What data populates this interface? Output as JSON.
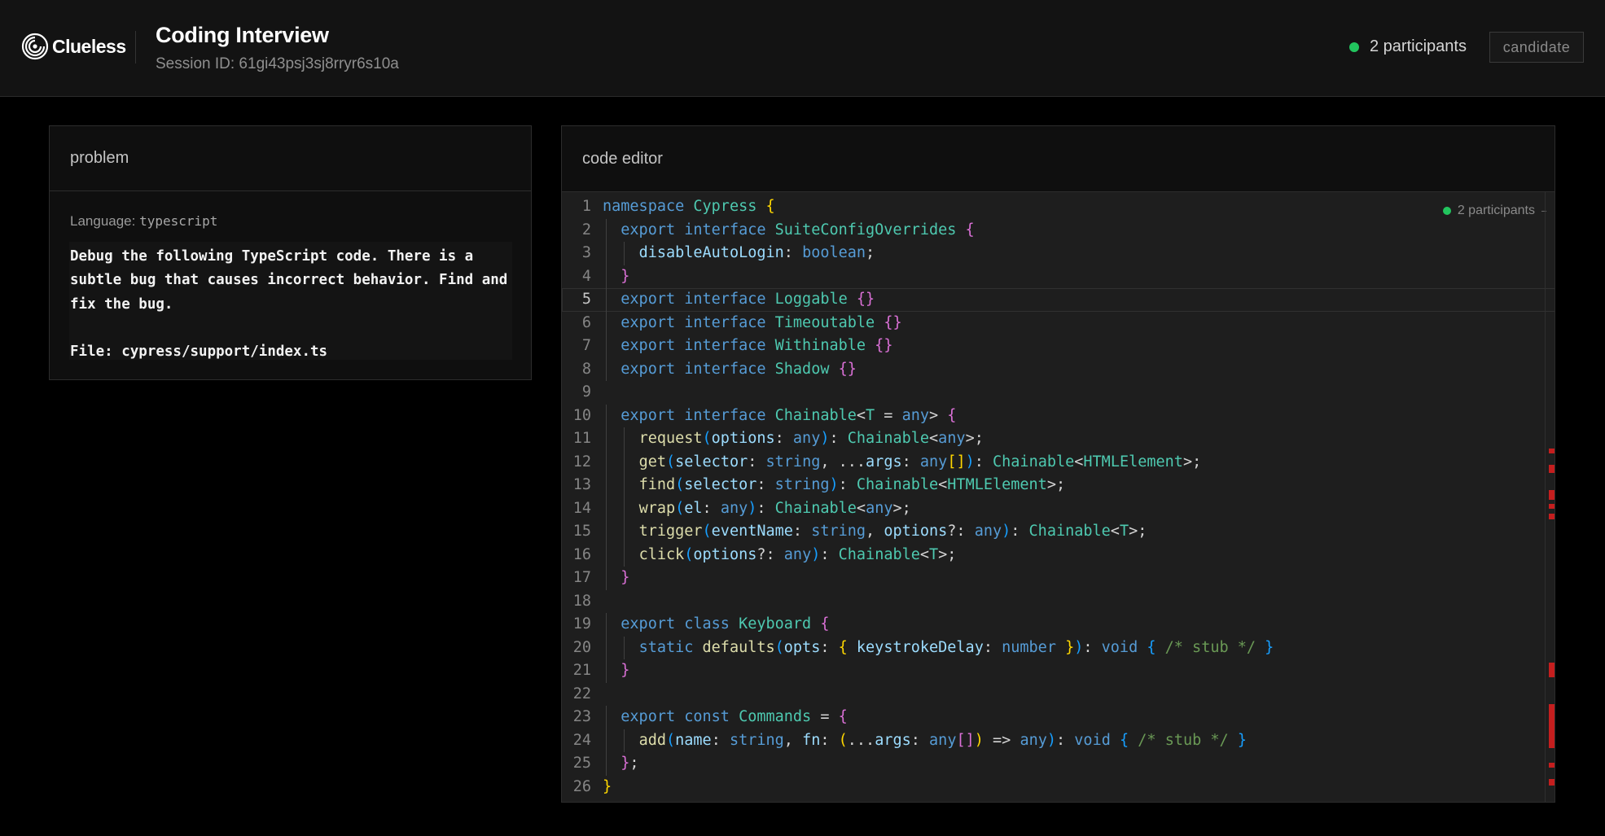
{
  "header": {
    "logo_text": "Clueless",
    "title": "Coding Interview",
    "session": "Session ID: 61gi43psj3sj8rryr6s10a",
    "participants": "2 participants",
    "role": "candidate"
  },
  "problem": {
    "heading": "problem",
    "language_label": "Language:",
    "language_value": "typescript",
    "description": "Debug the following TypeScript code. There is a\nsubtle bug that causes incorrect behavior. Find and\nfix the bug.\n\nFile: cypress/support/index.ts"
  },
  "editor": {
    "heading": "code editor",
    "participants": "2 participants",
    "current_line": 5,
    "lines": [
      "namespace Cypress {",
      "  export interface SuiteConfigOverrides {",
      "    disableAutoLogin: boolean;",
      "  }",
      "  export interface Loggable {}",
      "  export interface Timeoutable {}",
      "  export interface Withinable {}",
      "  export interface Shadow {}",
      "",
      "  export interface Chainable<T = any> {",
      "    request(options: any): Chainable<any>;",
      "    get(selector: string, ...args: any[]): Chainable<HTMLElement>;",
      "    find(selector: string): Chainable<HTMLElement>;",
      "    wrap(el: any): Chainable<any>;",
      "    trigger(eventName: string, options?: any): Chainable<T>;",
      "    click(options?: any): Chainable<T>;",
      "  }",
      "",
      "  export class Keyboard {",
      "    static defaults(opts: { keystrokeDelay: number }): void { /* stub */ }",
      "  }",
      "",
      "  export const Commands = {",
      "    add(name: string, fn: (...args: any[]) => any): void { /* stub */ }",
      "  };",
      "}",
      ""
    ]
  },
  "colors": {
    "accent_green": "#22c55e",
    "error_marker": "#c41e1e",
    "keyword": "#569cd6",
    "type": "#4ec9b0",
    "param": "#9cdcfe",
    "function": "#dcdcaa",
    "comment": "#6a9955"
  },
  "icons": {
    "logo": "clueless-logo-icon",
    "status": "status-dot-icon"
  }
}
